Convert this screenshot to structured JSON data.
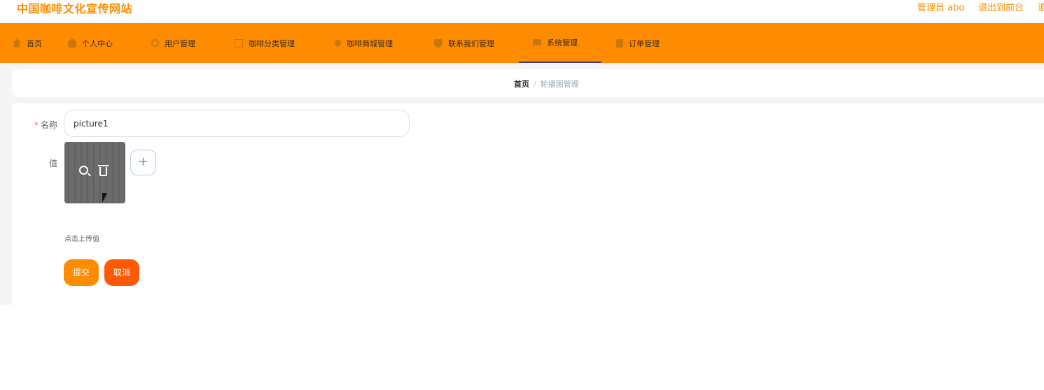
{
  "header": {
    "site_title": "中国咖啡文化宣传网站",
    "user_label": "管理员 abo",
    "front_link": "退出到前台",
    "logout_link": "退"
  },
  "nav": {
    "items": [
      {
        "label": "首页",
        "icon": "home-icon"
      },
      {
        "label": "个人中心",
        "icon": "user-icon"
      },
      {
        "label": "用户管理",
        "icon": "power-icon"
      },
      {
        "label": "咖啡分类管理",
        "icon": "checkbox-icon"
      },
      {
        "label": "咖啡商城管理",
        "icon": "location-icon"
      },
      {
        "label": "联系我们管理",
        "icon": "shield-icon"
      },
      {
        "label": "系统管理",
        "icon": "briefcase-icon"
      },
      {
        "label": "订单管理",
        "icon": "document-icon"
      }
    ],
    "active": "系统管理"
  },
  "breadcrumb": {
    "home": "首页",
    "separator": "/",
    "current": "轮播图管理"
  },
  "form": {
    "name_label": "名称",
    "name_value": "picture1",
    "value_label": "值",
    "upload_hint": "点击上传值",
    "add_symbol": "+",
    "submit_label": "提交",
    "cancel_label": "取消"
  },
  "colors": {
    "accent": "#ff8c00",
    "cancel": "#ff5a00",
    "active_underline": "#4a3a8a"
  }
}
